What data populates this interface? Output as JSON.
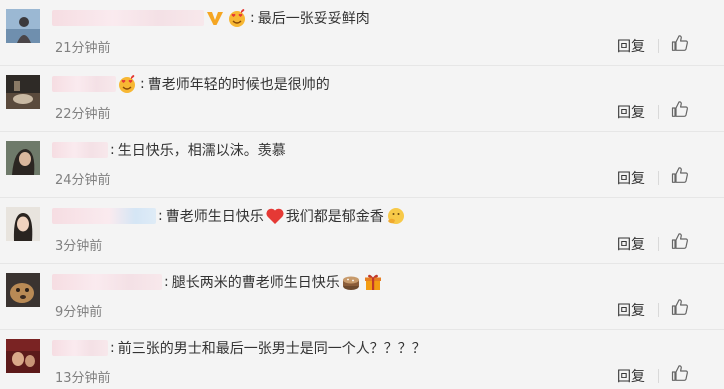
{
  "comments": [
    {
      "content": "最后一张妥妥鲜肉",
      "time": "21分钟前",
      "reply_label": "回复",
      "like_count": "",
      "badges": [
        "vip-v-icon",
        "love-face-emoji"
      ]
    },
    {
      "content": "曹老师年轻的时候也是很帅的",
      "time": "22分钟前",
      "reply_label": "回复",
      "like_count": "",
      "badges": [
        "love-face-emoji"
      ]
    },
    {
      "content": "生日快乐，相濡以沫。羡慕",
      "time": "24分钟前",
      "reply_label": "回复",
      "like_count": "",
      "badges": []
    },
    {
      "content_before": "曹老师生日快乐",
      "content_middle": "我们都是郁金香",
      "time": "3分钟前",
      "reply_label": "回复",
      "like_count": "",
      "badges": [
        "heart-emoji",
        "thinking-emoji"
      ]
    },
    {
      "content": "腿长两米的曹老师生日快乐",
      "time": "9分钟前",
      "reply_label": "回复",
      "like_count": "",
      "badges": [
        "cake-emoji",
        "gift-emoji"
      ]
    },
    {
      "content": "前三张的男士和最后一张男士是同一个人？？？？",
      "time": "13分钟前",
      "reply_label": "回复",
      "like_count": "",
      "badges": []
    }
  ],
  "colors": {
    "background": "#f4f4f4",
    "text": "#333333",
    "time": "#808080",
    "divider": "#e6e6e6",
    "vip_badge": "#f5a623"
  },
  "icons": {
    "like": "thumbs-up-icon"
  }
}
